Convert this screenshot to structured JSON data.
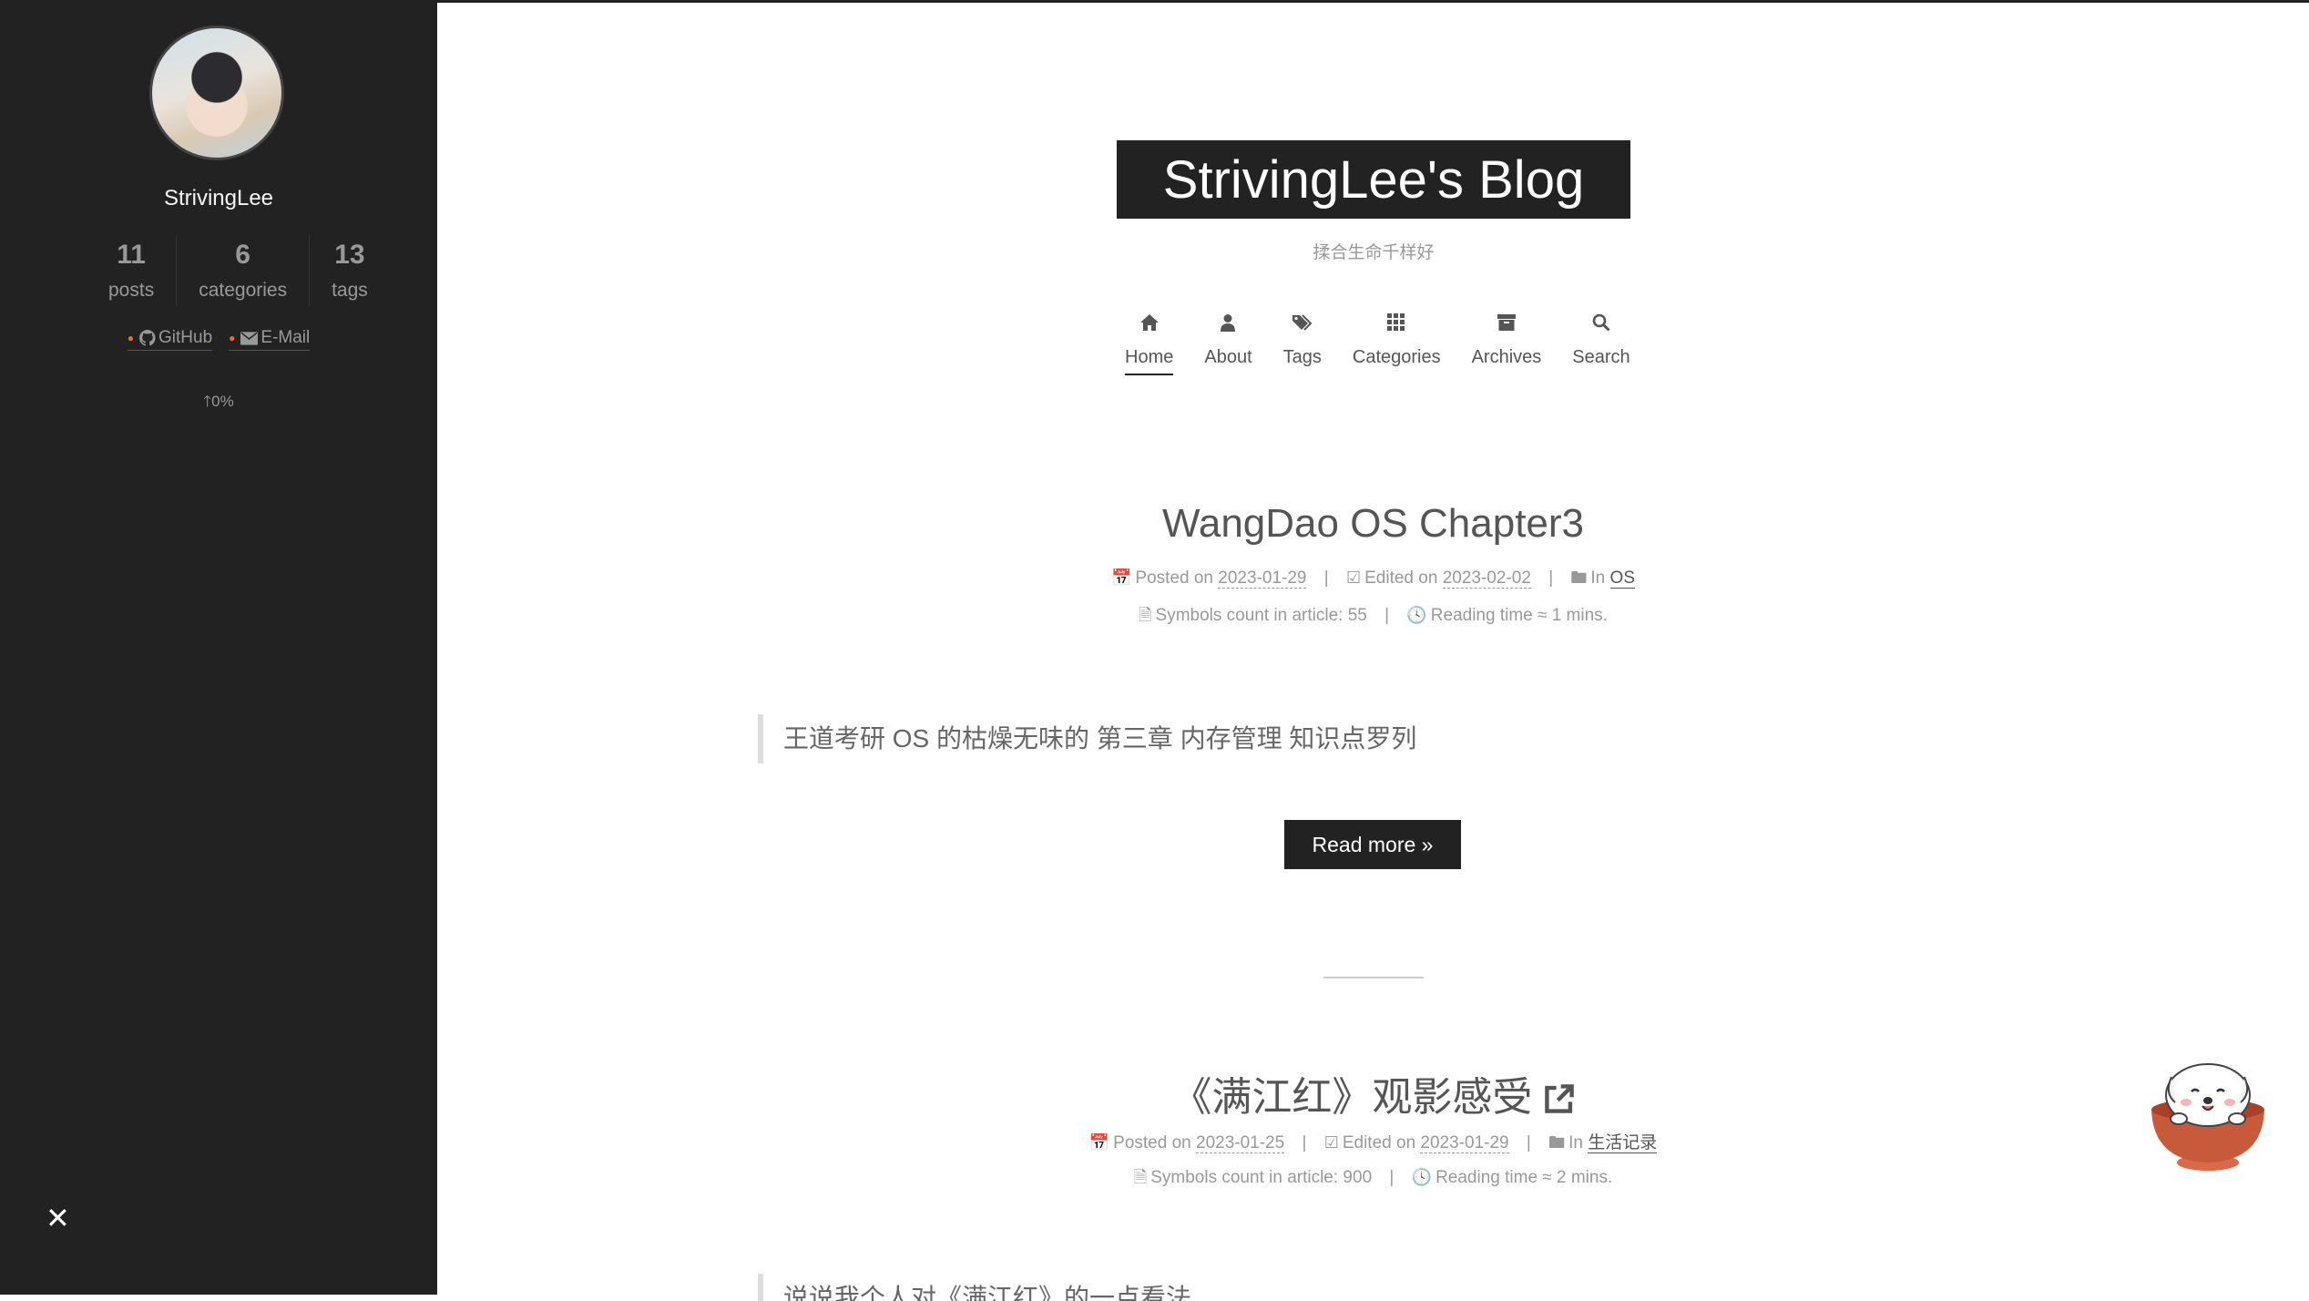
{
  "sidebar": {
    "author": "StrivingLee",
    "stats": [
      {
        "count": "11",
        "label": "posts"
      },
      {
        "count": "6",
        "label": "categories"
      },
      {
        "count": "13",
        "label": "tags"
      }
    ],
    "links": [
      {
        "label": "GitHub",
        "icon": "github-icon"
      },
      {
        "label": "E-Mail",
        "icon": "envelope-icon"
      }
    ],
    "progress": "0%",
    "close": "✕"
  },
  "header": {
    "title": "StrivingLee's Blog",
    "subtitle": "揉合生命千样好",
    "menu": [
      {
        "label": "Home",
        "icon": "home-icon"
      },
      {
        "label": "About",
        "icon": "user-icon"
      },
      {
        "label": "Tags",
        "icon": "tags-icon"
      },
      {
        "label": "Categories",
        "icon": "grid-icon"
      },
      {
        "label": "Archives",
        "icon": "archive-icon"
      },
      {
        "label": "Search",
        "icon": "search-icon"
      }
    ]
  },
  "posts": [
    {
      "title": "WangDao OS Chapter3",
      "posted_label": "Posted on",
      "posted": "2023-01-29",
      "edited_label": "Edited on",
      "edited": "2023-02-02",
      "in_label": "In",
      "category": "OS",
      "symbols": "Symbols count in article: 55",
      "reading": "Reading time ≈ 1 mins.",
      "excerpt": "王道考研 OS 的枯燥无味的 第三章 内存管理 知识点罗列",
      "read_more": "Read more »"
    },
    {
      "title": "《满江红》观影感受",
      "posted_label": "Posted on",
      "posted": "2023-01-25",
      "edited_label": "Edited on",
      "edited": "2023-01-29",
      "in_label": "In",
      "category": "生活记录",
      "symbols": "Symbols count in article: 900",
      "reading": "Reading time ≈ 2 mins.",
      "excerpt": "说说我个人对《满江红》的一点看法"
    }
  ]
}
